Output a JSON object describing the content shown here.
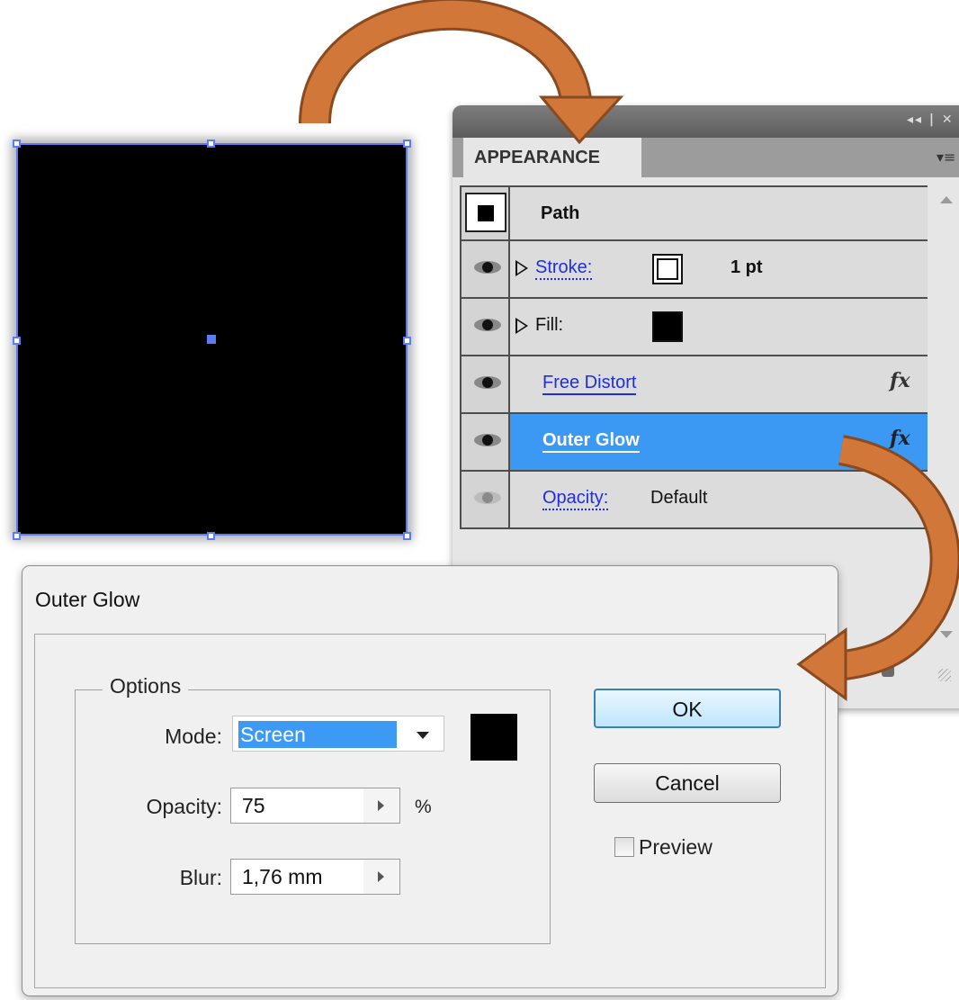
{
  "appearance_panel": {
    "tab_title": "APPEARANCE",
    "header": {
      "label": "Path"
    },
    "rows": [
      {
        "label": "Stroke:",
        "value": "1 pt",
        "swatch": "#ffffff"
      },
      {
        "label": "Fill:",
        "swatch": "#000000"
      },
      {
        "label": "Free Distort",
        "fx": "fx"
      },
      {
        "label": "Outer Glow",
        "fx": "fx",
        "selected": true
      },
      {
        "label": "Opacity:",
        "value": "Default"
      }
    ]
  },
  "dialog": {
    "title": "Outer Glow",
    "group_label": "Options",
    "mode": {
      "label": "Mode:",
      "value": "Screen",
      "color": "#000000"
    },
    "opacity": {
      "label": "Opacity:",
      "value": "75",
      "unit": "%"
    },
    "blur": {
      "label": "Blur:",
      "value": "1,76 mm"
    },
    "ok_label": "OK",
    "cancel_label": "Cancel",
    "preview_label": "Preview",
    "preview_checked": false
  },
  "colors": {
    "selection": "#5b7cf5",
    "highlight": "#3b98f3",
    "arrow": "#d2773a"
  }
}
